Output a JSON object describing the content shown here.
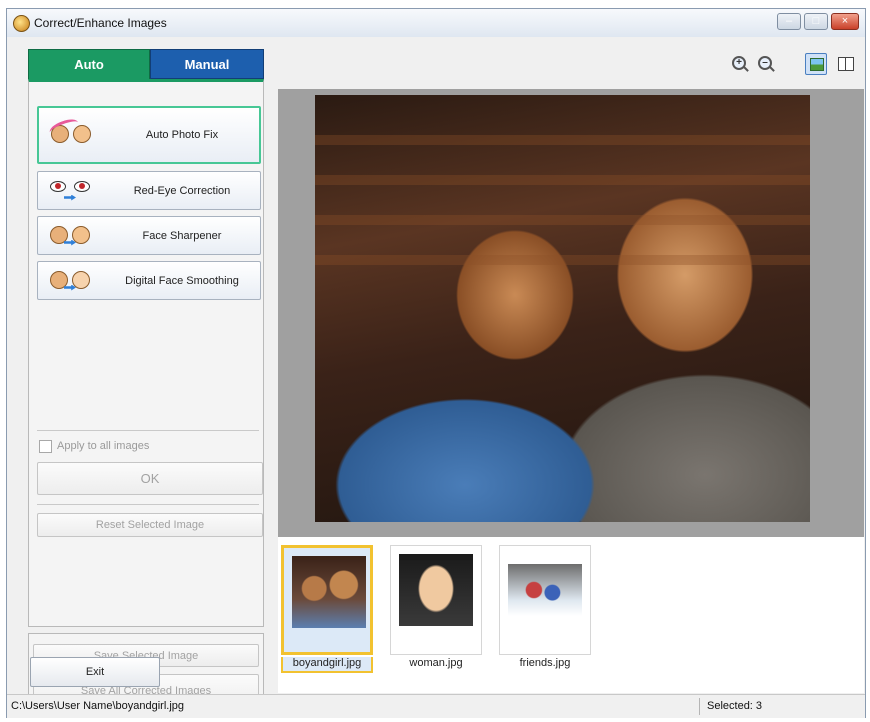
{
  "window": {
    "title": "Correct/Enhance Images",
    "buttons": {
      "minimize": "–",
      "maximize": "□",
      "close": "×"
    }
  },
  "tabs": [
    {
      "label": "Auto",
      "active": true
    },
    {
      "label": "Manual",
      "active": false
    }
  ],
  "auto_panel": {
    "tools": [
      {
        "label": "Auto Photo Fix",
        "icon": "auto-photo-fix-icon",
        "selected": true
      },
      {
        "label": "Red-Eye Correction",
        "icon": "red-eye-icon"
      },
      {
        "label": "Face Sharpener",
        "icon": "face-sharpener-icon"
      },
      {
        "label": "Digital Face Smoothing",
        "icon": "face-smoothing-icon"
      }
    ],
    "apply_all_label": "Apply to all images",
    "ok_label": "OK",
    "reset_label": "Reset Selected Image"
  },
  "save_panel": {
    "save_selected_label": "Save Selected Image",
    "save_all_label": "Save All Corrected Images"
  },
  "exit_label": "Exit",
  "toolbar": {
    "icons": [
      "zoom-in-icon",
      "zoom-out-icon",
      "full-image-icon",
      "compare-icon"
    ]
  },
  "thumbnails": [
    {
      "name": "boyandgirl.jpg",
      "selected": true
    },
    {
      "name": "woman.jpg",
      "selected": false
    },
    {
      "name": "friends.jpg",
      "selected": false
    }
  ],
  "status": {
    "path": "C:\\Users\\User Name\\boyandgirl.jpg",
    "selected": "Selected: 3"
  },
  "colors": {
    "auto_tab": "#1b9a63",
    "manual_tab": "#1d5fae",
    "selected_thumb_border": "#f2c230"
  }
}
